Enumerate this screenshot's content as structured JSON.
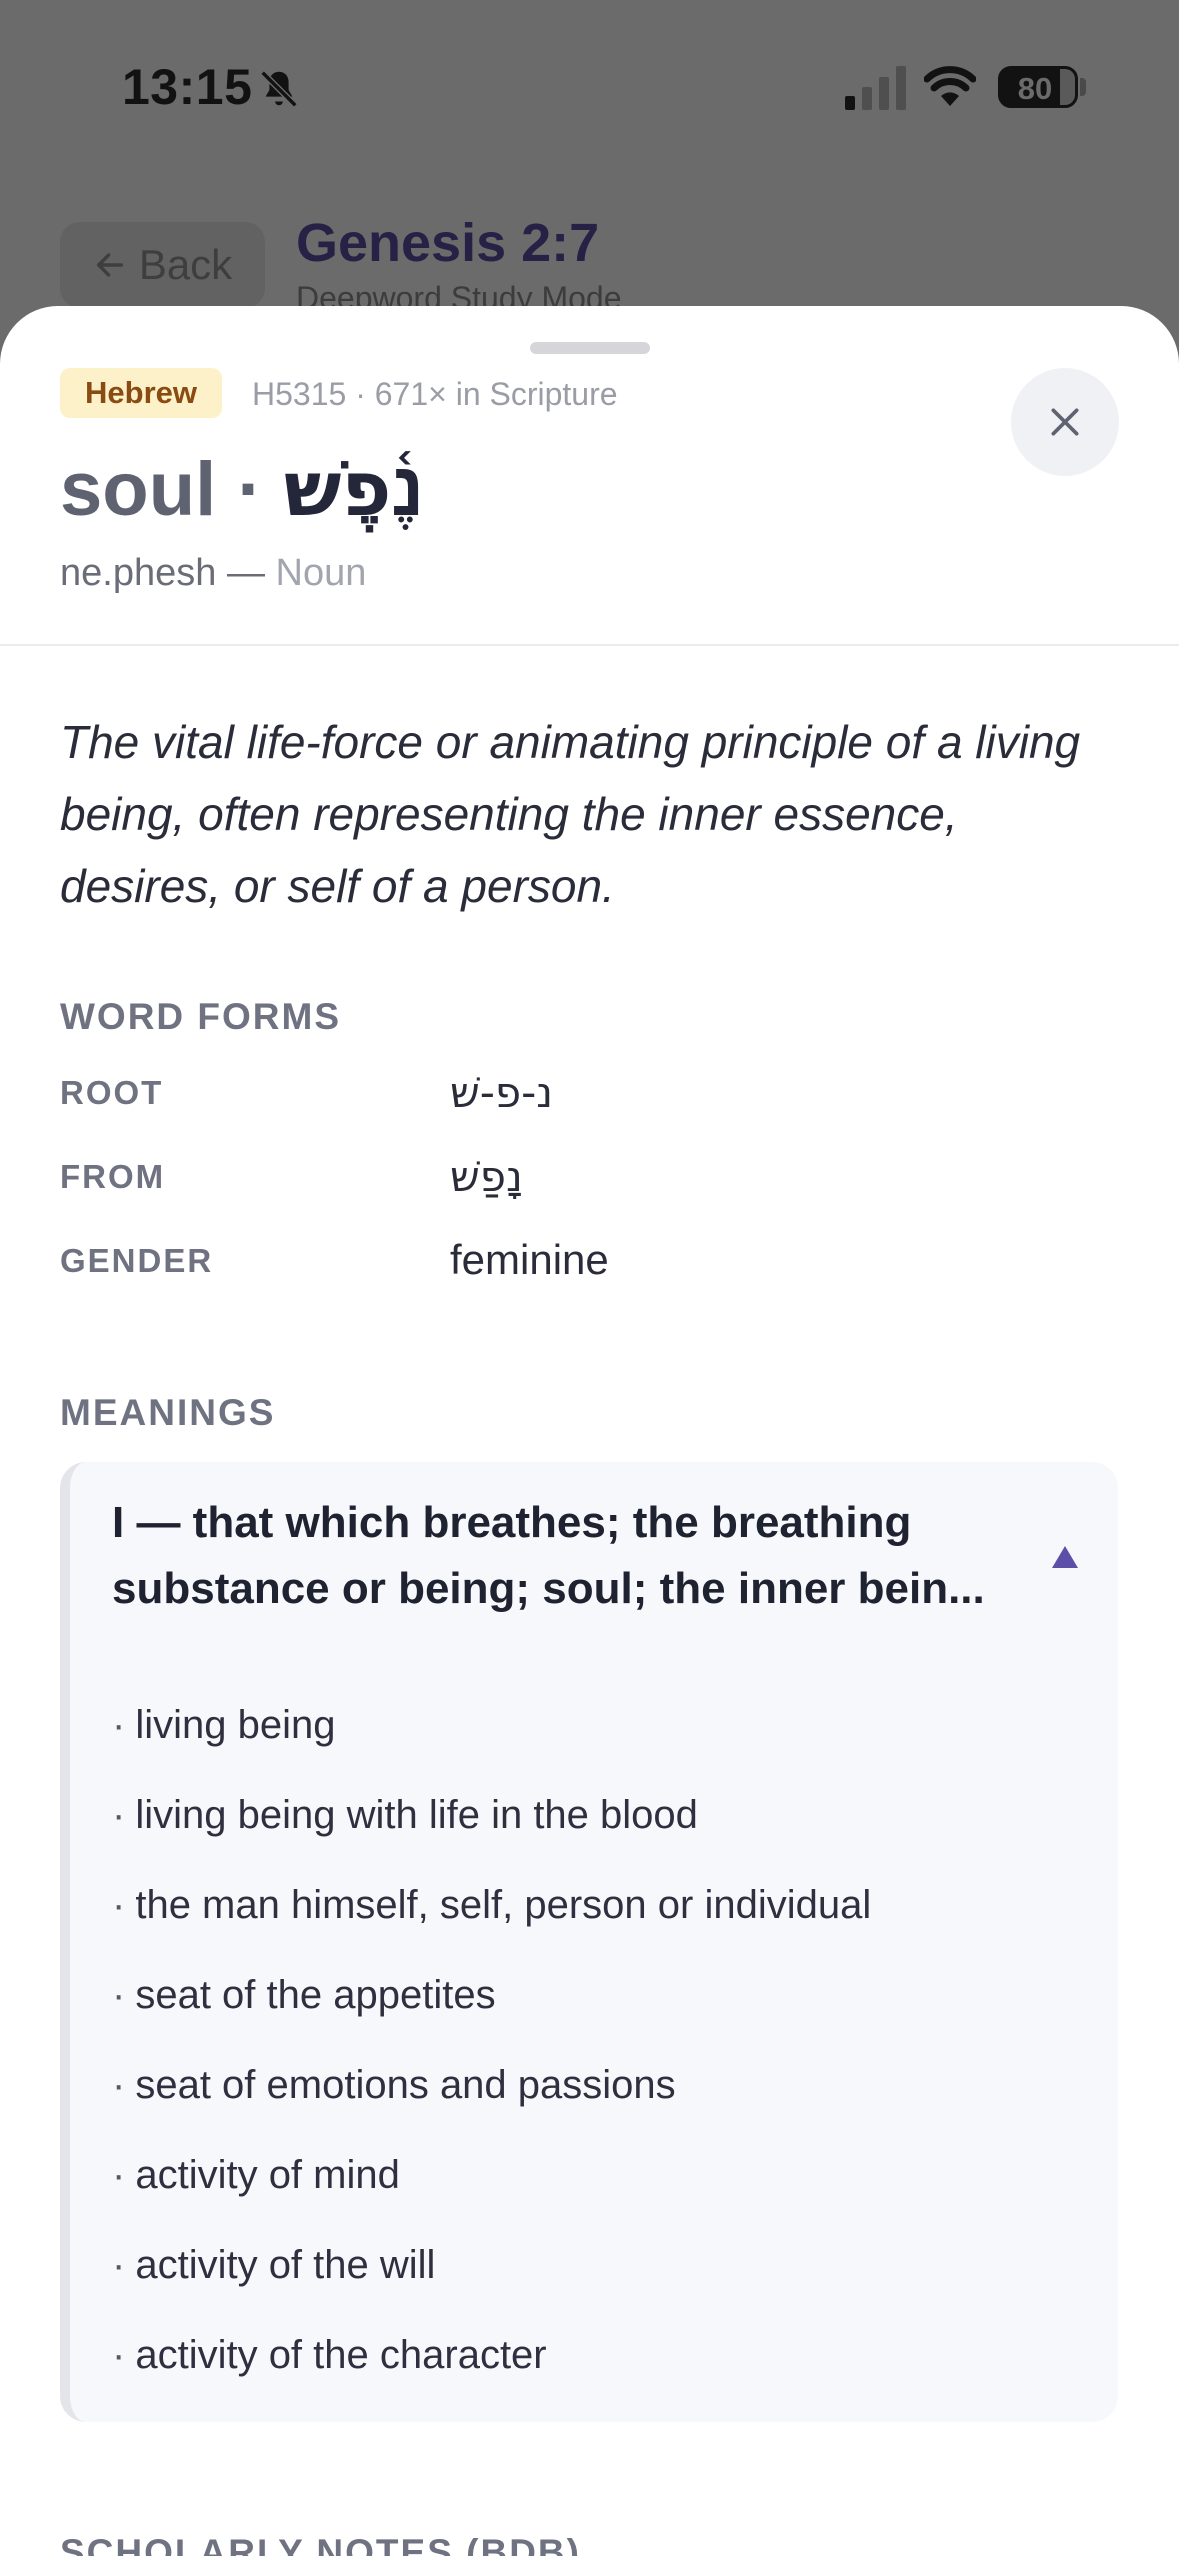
{
  "status_bar": {
    "time": "13:15",
    "silent_icon": "bell-slash-icon",
    "signal_icon": "cellular-signal-icon",
    "wifi_icon": "wifi-icon",
    "battery_level": "80"
  },
  "background_screen": {
    "back_label": "Back",
    "title": "Genesis 2:7",
    "subtitle": "Deepword Study Mode"
  },
  "sheet": {
    "language_badge": "Hebrew",
    "strongs_meta": "H5315 · 671× in Scripture",
    "headword_english": "soul",
    "headword_separator": " · ",
    "headword_hebrew": "נֶ֫פֶשׁ",
    "transliteration": "ne.phesh",
    "part_of_speech": "Noun",
    "definition": "The vital life-force or animating principle of a living being, often representing the inner essence, desires, or self of a person.",
    "word_forms": {
      "heading": "WORD FORMS",
      "rows": [
        {
          "label": "ROOT",
          "value": "נ-פ-שׁ"
        },
        {
          "label": "FROM",
          "value": "נָפַשׁ"
        },
        {
          "label": "GENDER",
          "value": "feminine"
        }
      ]
    },
    "meanings": {
      "heading": "MEANINGS",
      "group_title": "I — that which breathes; the breathing substance or being; soul; the inner bein...",
      "items": [
        "living being",
        "living being with life in the blood",
        "the man himself, self, person or individual",
        "seat of the appetites",
        "seat of emotions and passions",
        "activity of mind",
        "activity of the will",
        "activity of the character"
      ]
    },
    "notes_heading": "SCHOLARLY NOTES (BDB)"
  },
  "colors": {
    "accent": "#5b4fa8",
    "badge_bg": "#fdf1c9",
    "badge_text": "#8a4b12"
  }
}
